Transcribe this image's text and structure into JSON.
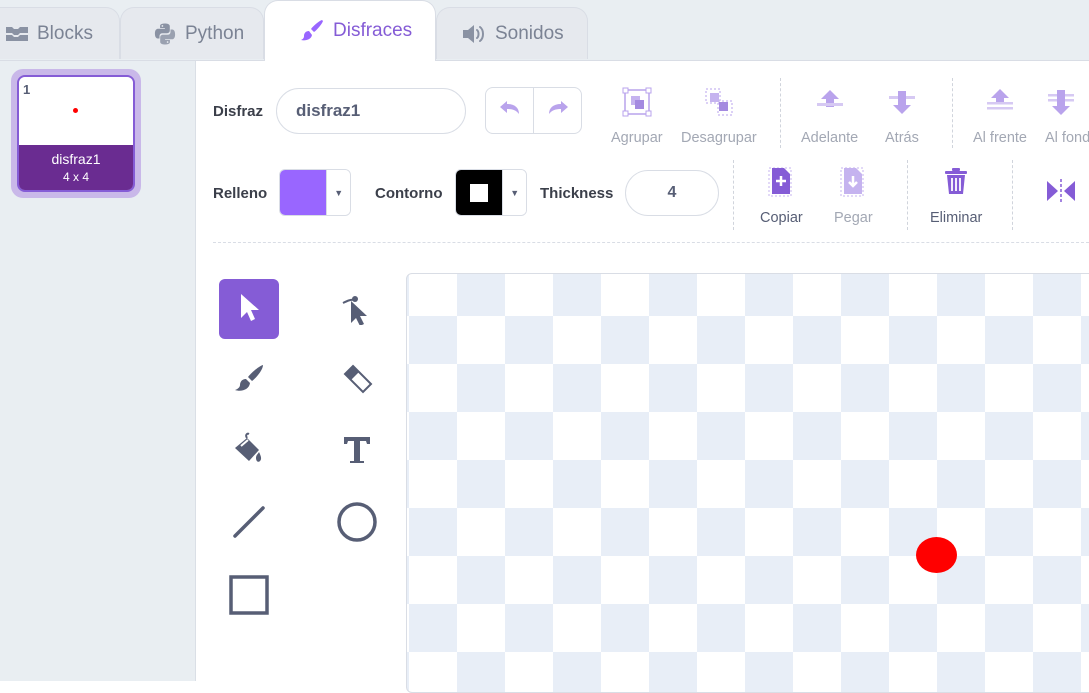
{
  "tabs": [
    {
      "label": "Blocks",
      "icon": "blocks-icon"
    },
    {
      "label": "Python",
      "icon": "python-icon"
    },
    {
      "label": "Disfraces",
      "icon": "paintbrush-icon",
      "active": true
    },
    {
      "label": "Sonidos",
      "icon": "speaker-icon"
    }
  ],
  "costumes": [
    {
      "number": "1",
      "name": "disfraz1",
      "size": "4 x 4",
      "selected": true
    }
  ],
  "toolbar": {
    "costume_label": "Disfraz",
    "costume_name": "disfraz1",
    "group": "Agrupar",
    "ungroup": "Desagrupar",
    "forward": "Adelante",
    "backward": "Atrás",
    "front": "Al frente",
    "back": "Al fondo",
    "fill_label": "Relleno",
    "outline_label": "Contorno",
    "thickness_label": "Thickness",
    "thickness_value": "4",
    "copy": "Copiar",
    "paste": "Pegar",
    "delete": "Eliminar"
  },
  "colors": {
    "accent": "#855cd6",
    "fill": "#9966ff",
    "outline": "#000000",
    "shape": "#ff0000"
  },
  "tools": [
    "select",
    "reshape",
    "brush",
    "eraser",
    "fill",
    "text",
    "line",
    "circle",
    "rectangle"
  ],
  "selected_tool": "select"
}
